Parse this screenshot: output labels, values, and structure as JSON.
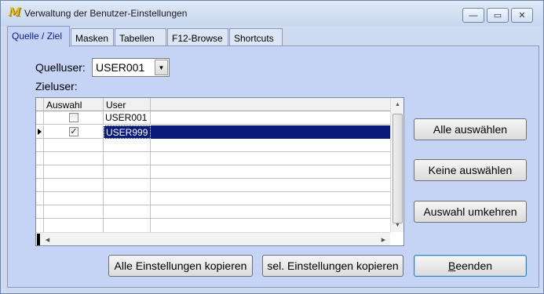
{
  "window": {
    "title": "Verwaltung der Benutzer-Einstellungen",
    "app_icon_glyph": "M",
    "controls": {
      "minimize": "—",
      "maximize": "▭",
      "close": "✕"
    }
  },
  "tabs": [
    {
      "label": "Quelle / Ziel",
      "active": true
    },
    {
      "label": "Masken",
      "active": false
    },
    {
      "label": "Tabellen",
      "active": false
    },
    {
      "label": "F12-Browse",
      "active": false
    },
    {
      "label": "Shortcuts",
      "active": false
    }
  ],
  "source": {
    "label": "Quelluser:",
    "value": "USER001"
  },
  "target": {
    "label": "Zieluser:"
  },
  "grid": {
    "columns": [
      "Auswahl",
      "User"
    ],
    "rows": [
      {
        "checked": false,
        "mark": "",
        "user": "USER001",
        "selected": false
      },
      {
        "checked": true,
        "mark": "✓",
        "user": "USER999",
        "selected": true
      }
    ]
  },
  "buttons": {
    "select_all": "Alle auswählen",
    "select_none": "Keine auswählen",
    "invert": "Auswahl umkehren",
    "copy_all": "Alle Einstellungen kopieren",
    "copy_selected": "sel. Einstellungen kopieren",
    "exit_underline": "B",
    "exit_rest": "eenden"
  },
  "colors": {
    "panel": "#c5d4f5",
    "selection": "#0a1a7a",
    "active_tab_text": "#0a1a8a"
  }
}
